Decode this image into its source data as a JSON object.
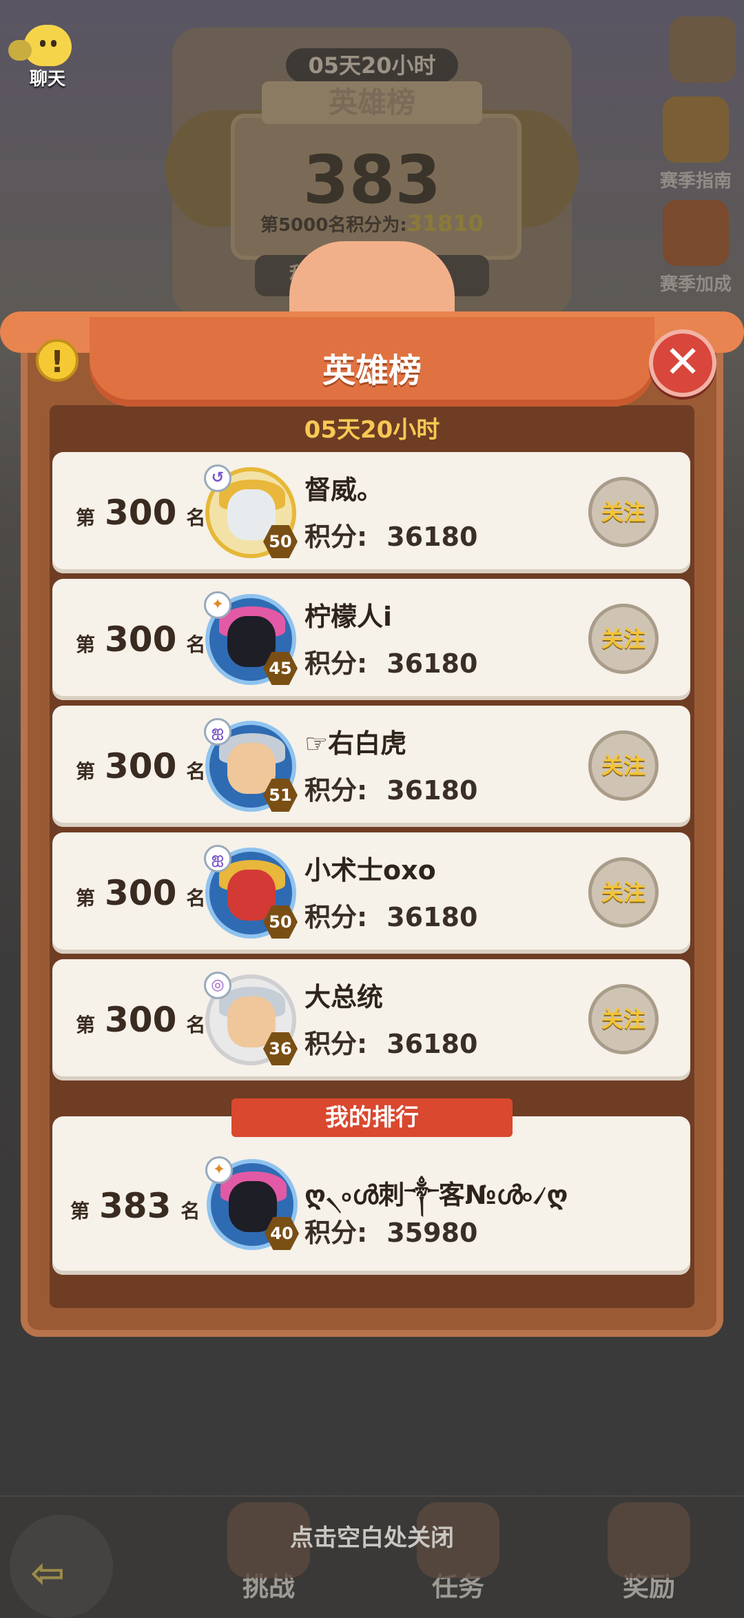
{
  "background": {
    "timer": "05天20小时",
    "title": "英雄榜",
    "my_score": "383",
    "rank5000_label": "第5000名积分为:",
    "rank5000_value": "31810",
    "score_bar": "积分",
    "side_buttons": {
      "guide": "赛季指南",
      "bonus": "赛季加成"
    },
    "chat_label": "聊天"
  },
  "panel": {
    "title": "英雄榜",
    "timer": "05天20小时",
    "follow_label": "关注",
    "rank_prefix": "第",
    "rank_suffix": "名",
    "score_label": "积分:",
    "entries": [
      {
        "rank": "300",
        "name": "督威。",
        "score": "36180",
        "level": "50"
      },
      {
        "rank": "300",
        "name": "柠檬人i",
        "score": "36180",
        "level": "45"
      },
      {
        "rank": "300",
        "name": "☞右白虎",
        "score": "36180",
        "level": "51"
      },
      {
        "rank": "300",
        "name": "小术士oxo",
        "score": "36180",
        "level": "50"
      },
      {
        "rank": "300",
        "name": "大总统",
        "score": "36180",
        "level": "36"
      }
    ],
    "my_rank_title": "我的排行",
    "my_entry": {
      "rank": "383",
      "name": "ღ৲৹ൾ刺༒客№ൾ৹৴ღ",
      "score": "35980",
      "level": "40"
    }
  },
  "bottom": {
    "hint": "点击空白处关闭",
    "tabs": [
      "挑战",
      "任务",
      "奖励"
    ]
  }
}
